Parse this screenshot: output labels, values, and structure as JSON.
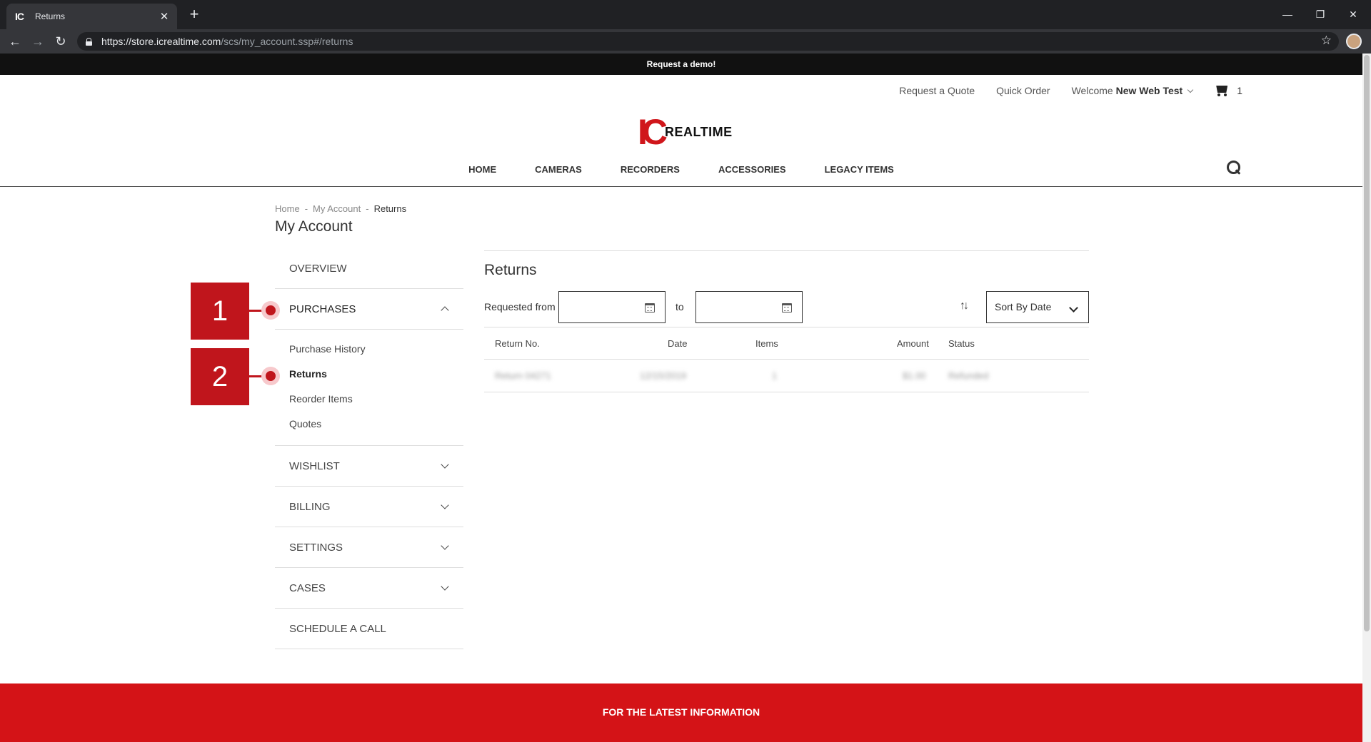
{
  "browser": {
    "tab_title": "Returns",
    "tab_favicon": "IC",
    "url_host": "https://store.icrealtime.com",
    "url_path": "/scs/my_account.ssp#/returns"
  },
  "promo_text": "Request a demo!",
  "top_links": {
    "request_quote": "Request a Quote",
    "quick_order": "Quick Order",
    "welcome_prefix": "Welcome",
    "user_name": "New Web Test",
    "cart_count": "1"
  },
  "logo": {
    "mark": "IC",
    "wordmark": "REALTIME",
    "brand_color": "#d0161b"
  },
  "main_nav": [
    "HOME",
    "CAMERAS",
    "RECORDERS",
    "ACCESSORIES",
    "LEGACY ITEMS"
  ],
  "breadcrumb": {
    "home": "Home",
    "account": "My Account",
    "current": "Returns"
  },
  "page_title": "My Account",
  "sidebar": {
    "overview": "OVERVIEW",
    "purchases": "PURCHASES",
    "purchases_items": [
      "Purchase History",
      "Returns",
      "Reorder Items",
      "Quotes"
    ],
    "wishlist": "WISHLIST",
    "billing": "BILLING",
    "settings": "SETTINGS",
    "cases": "CASES",
    "schedule": "SCHEDULE A CALL"
  },
  "annotations": [
    "1",
    "2"
  ],
  "returns": {
    "title": "Returns",
    "requested_from_label": "Requested from",
    "to_label": "to",
    "sort_label": "Sort By Date",
    "columns": [
      "Return No.",
      "Date",
      "Items",
      "Amount",
      "Status"
    ],
    "rows": [
      {
        "return_no": "Return 04271",
        "date": "12/15/2019",
        "items": "1",
        "amount": "$1.00",
        "status": "Refunded"
      }
    ]
  },
  "footer_text": "FOR THE LATEST INFORMATION",
  "colors": {
    "accent_red": "#d41317",
    "annotation_red": "#c0151c"
  }
}
